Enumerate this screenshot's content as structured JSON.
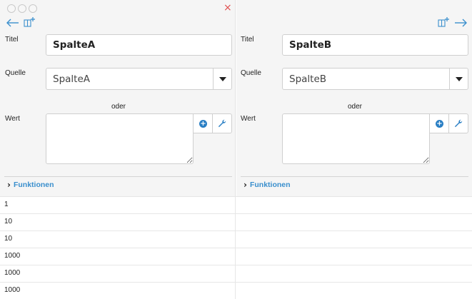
{
  "window": {
    "close_glyph": "×",
    "accent_color": "#3a8fcd",
    "close_color": "#e05050"
  },
  "columns": [
    {
      "title_label": "Titel",
      "title_value": "SpalteA",
      "source_label": "Quelle",
      "source_value": "SpalteA",
      "or_label": "oder",
      "value_label": "Wert",
      "functions_label": "Funktionen",
      "nav_icon": "arrow-left-icon"
    },
    {
      "title_label": "Titel",
      "title_value": "SpalteB",
      "source_label": "Quelle",
      "source_value": "SpalteB",
      "or_label": "oder",
      "value_label": "Wert",
      "functions_label": "Funktionen",
      "nav_icon": "arrow-right-icon"
    }
  ],
  "rows": [
    {
      "a": "1",
      "b": ""
    },
    {
      "a": "10",
      "b": ""
    },
    {
      "a": "10",
      "b": ""
    },
    {
      "a": "1000",
      "b": ""
    },
    {
      "a": "1000",
      "b": ""
    },
    {
      "a": "1000",
      "b": ""
    }
  ]
}
